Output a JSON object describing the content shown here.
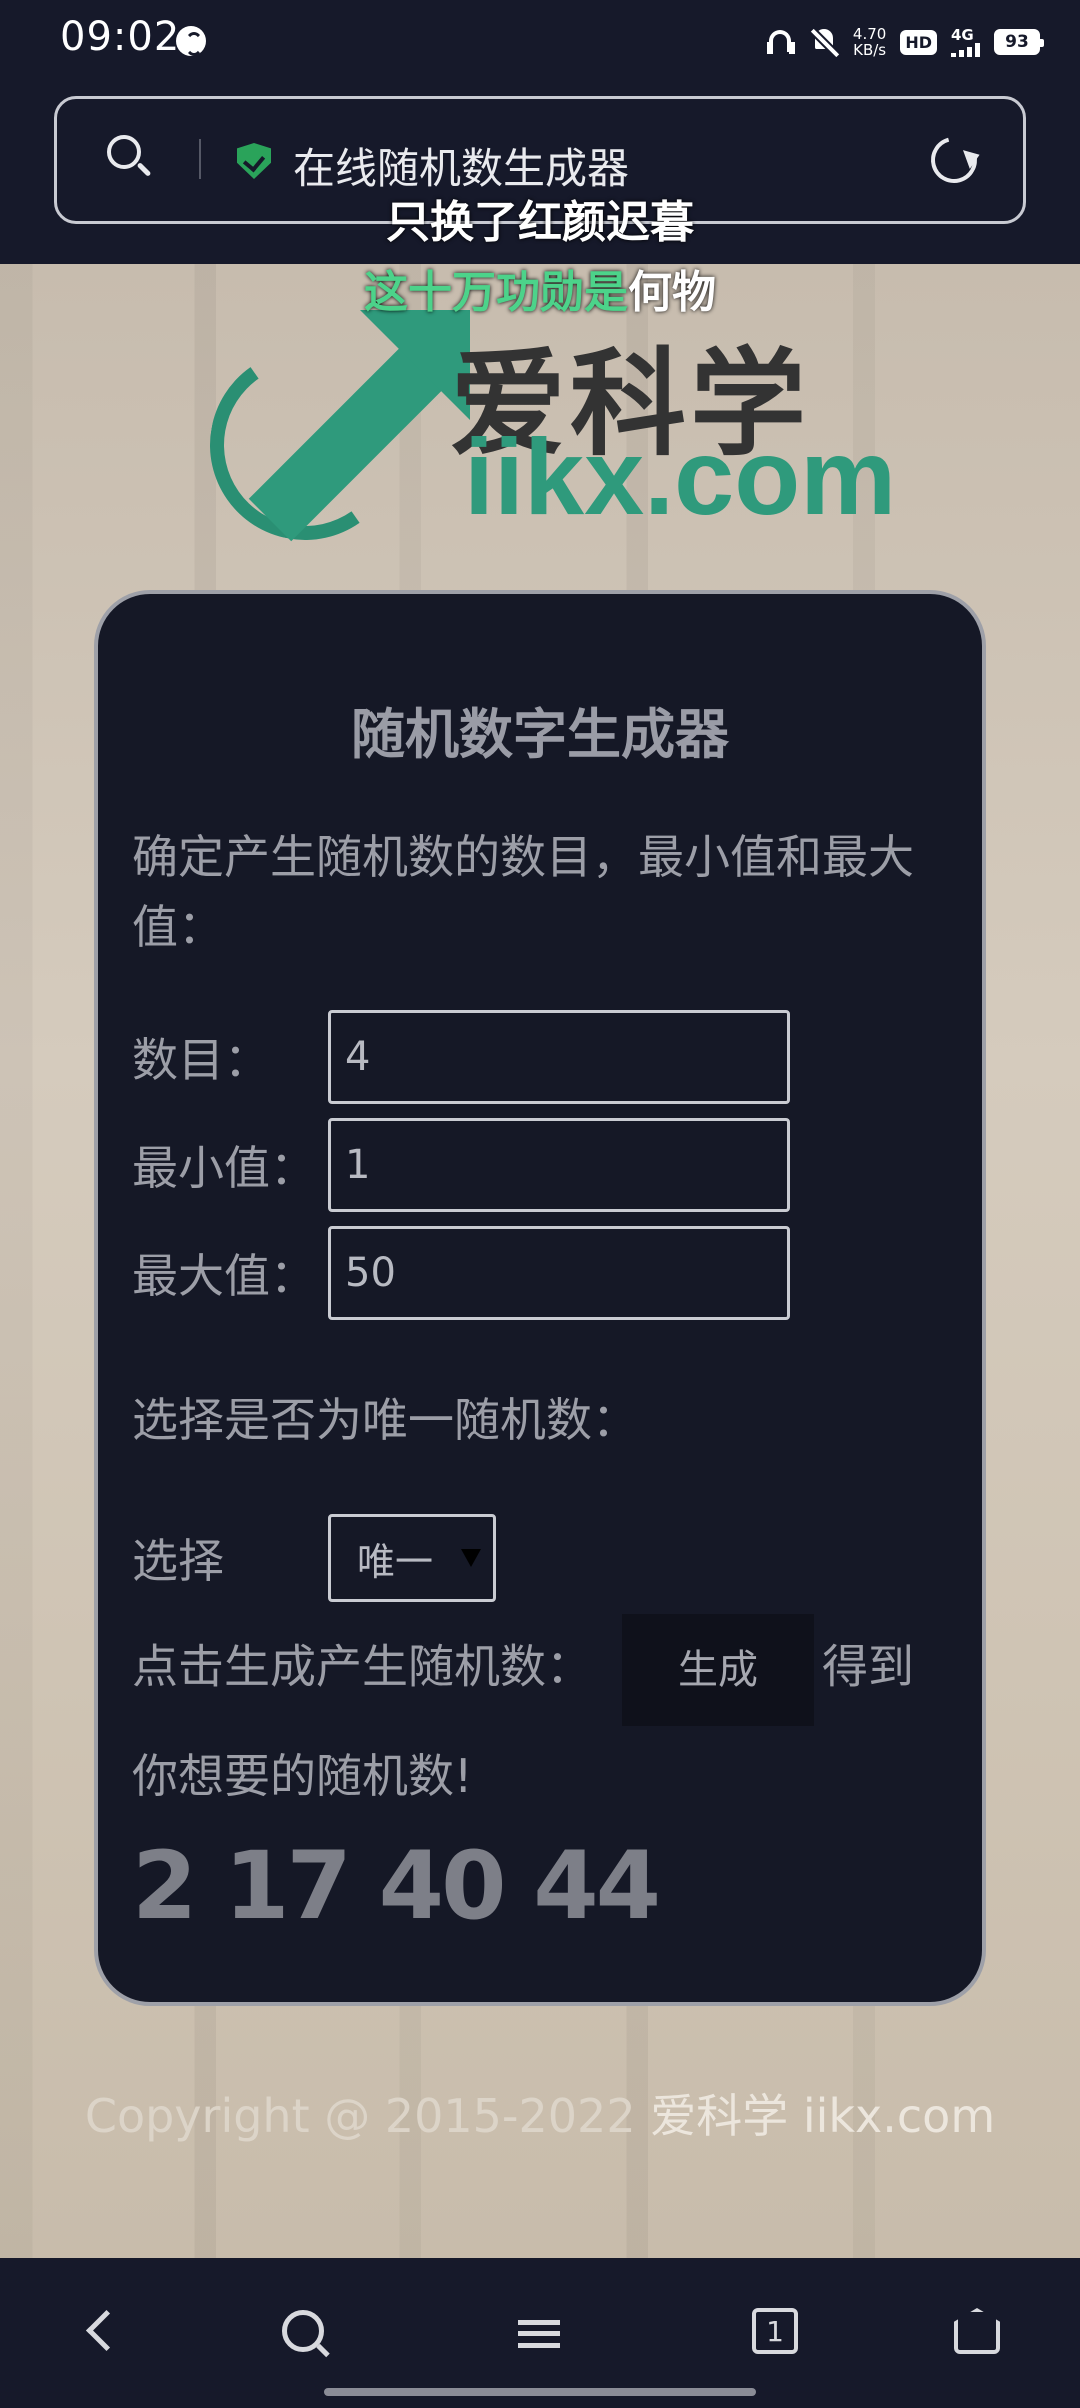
{
  "status_bar": {
    "time": "09:02",
    "net_speed_value": "4.70",
    "net_speed_unit": "KB/s",
    "hd_label": "HD",
    "signal_label": "4G",
    "battery": "93"
  },
  "address_bar": {
    "url_title": "在线随机数生成器"
  },
  "lyrics": {
    "line1": "只换了红颜迟暮",
    "line2_highlight": "这十万功勋是",
    "line2_rest": "何物"
  },
  "logo": {
    "cn": "爱科学",
    "en": "iikx.com"
  },
  "card": {
    "title": "随机数字生成器",
    "intro": "确定产生随机数的数目，最小值和最大值：",
    "count_label": "数目：",
    "count_value": "4",
    "min_label": "最小值：",
    "min_value": "1",
    "max_label": "最大值：",
    "max_value": "50",
    "unique_prompt": "选择是否为唯一随机数：",
    "select_label": "选择",
    "select_value": "唯一",
    "generate_prefix": "点击生成产生随机数：",
    "generate_button": "生成",
    "generate_suffix": "得到你想要的随机数!",
    "result": "2 17 40 44"
  },
  "footer": {
    "copyright": "Copyright @ 2015-2022",
    "brand": "爱科学 iikx.com"
  },
  "bottom_nav": {
    "tabs_count": "1"
  }
}
